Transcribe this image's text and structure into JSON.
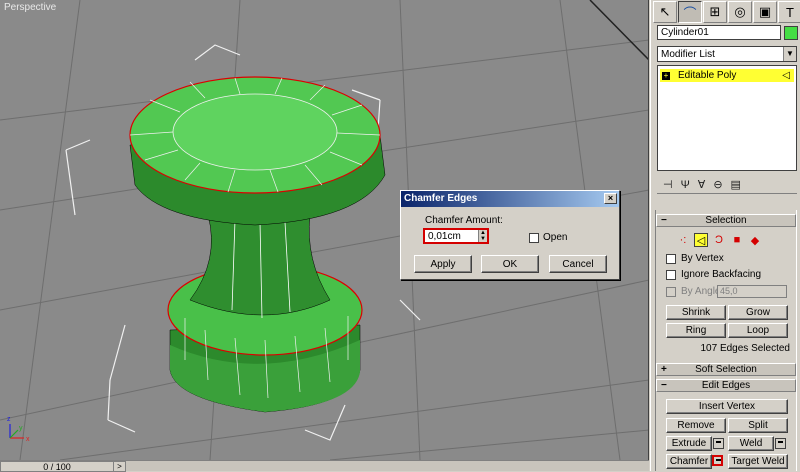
{
  "viewport": {
    "label": "Perspective"
  },
  "timeline": {
    "position": "0 / 100",
    "next_arrow": ">"
  },
  "colors": {
    "object": "#44dd44",
    "viewport_bg": "#8a8a8a",
    "selection_highlight": "#ffff33",
    "edge_selected": "#dd0000"
  },
  "panel": {
    "tabs": [
      "create-icon",
      "modify-icon",
      "hierarchy-icon",
      "motion-icon",
      "display-icon",
      "utilities-icon"
    ],
    "object_name": "Cylinder01",
    "modifier_list": "Modifier List",
    "stack": {
      "item": "Editable Poly"
    },
    "selection": {
      "title": "Selection",
      "by_vertex": "By Vertex",
      "ignore_backfacing": "Ignore Backfacing",
      "by_angle": "By Angle:",
      "angle_value": "45,0",
      "shrink": "Shrink",
      "grow": "Grow",
      "ring": "Ring",
      "loop": "Loop",
      "status": "107 Edges Selected"
    },
    "soft_selection": {
      "title": "Soft Selection"
    },
    "edit_edges": {
      "title": "Edit Edges",
      "insert_vertex": "Insert Vertex",
      "remove": "Remove",
      "split": "Split",
      "extrude": "Extrude",
      "weld": "Weld",
      "chamfer": "Chamfer",
      "target_weld": "Target Weld"
    }
  },
  "dialog": {
    "title": "Chamfer Edges",
    "close": "×",
    "amount_label": "Chamfer Amount:",
    "amount_value": "0,01cm",
    "open_label": "Open",
    "apply": "Apply",
    "ok": "OK",
    "cancel": "Cancel"
  }
}
